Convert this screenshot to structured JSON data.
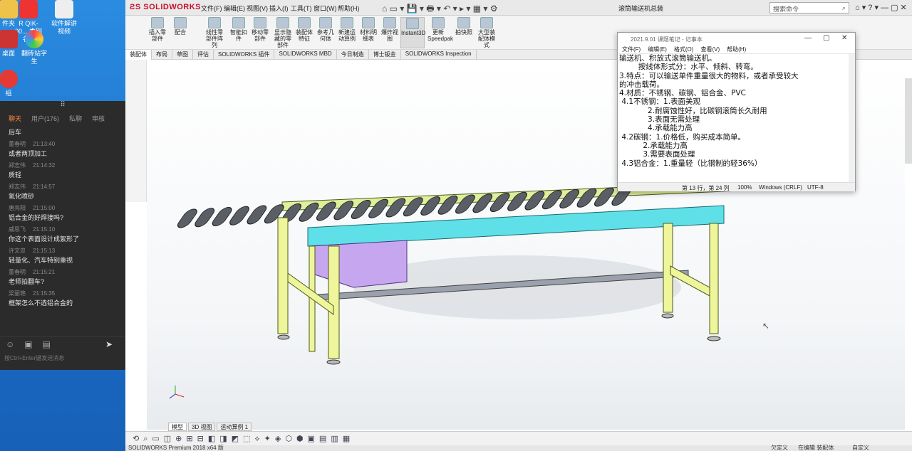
{
  "desktop": {
    "icons": [
      {
        "label": "件夹",
        "color": "#f1c24a"
      },
      {
        "label": "R QIK-00...\n类别名...",
        "color": "#e33"
      },
      {
        "label": "3",
        "color": "#ddd"
      },
      {
        "label": "软件解讲\n视频",
        "color": "#ddd"
      },
      {
        "label": "桌面",
        "color": "#c33"
      },
      {
        "label": "翻砖站字生",
        "color": "#4caf50"
      },
      {
        "label": "组",
        "color": "#e53935"
      }
    ]
  },
  "chat": {
    "tabs": [
      "聊天",
      "用户(176)",
      "私聊",
      "审核"
    ],
    "messages": [
      {
        "name": "",
        "time": "",
        "text": "后车"
      },
      {
        "name": "董春明",
        "time": "21:13:40",
        "text": "或者两顶加工"
      },
      {
        "name": "郑志伟",
        "time": "21:14:32",
        "text": "质轻"
      },
      {
        "name": "郑志伟",
        "time": "21:14:57",
        "text": "氧化喷砂"
      },
      {
        "name": "唐亮阳",
        "time": "21:15:00",
        "text": "铝合金的好焊接吗?"
      },
      {
        "name": "威思飞",
        "time": "21:15:10",
        "text": "你这个表面设计成絮形了"
      },
      {
        "name": "许文忠",
        "time": "21:15:13",
        "text": "轻量化、汽车特别重视"
      },
      {
        "name": "董春明",
        "time": "21:15:21",
        "text": "老师拍翻车?"
      },
      {
        "name": "梁丽艳",
        "time": "21:15:35",
        "text": "框架怎么不选铝合金的"
      }
    ],
    "hint": "按Ctrl+Enter键发送消息"
  },
  "solidworks": {
    "logo": "SOLIDWORKS",
    "menu": [
      "文件(F)",
      "编辑(E)",
      "视图(V)",
      "插入(I)",
      "工具(T)",
      "窗口(W)",
      "帮助(H)"
    ],
    "doc_title": "滚筒输送机总装",
    "search_placeholder": "搜索命令",
    "ribbon": [
      "插入零部件",
      "配合",
      "线性零部件阵列",
      "智能扣件",
      "移动零部件",
      "显示隐藏的零部件",
      "装配体特征",
      "参考几何体",
      "新建运动算例",
      "材料明细表",
      "爆炸视图",
      "Instant3D",
      "更新Speedpak",
      "拍快照",
      "大型装配体模式"
    ],
    "cm_tabs": [
      "装配体",
      "布局",
      "草图",
      "评估",
      "SOLIDWORKS 插件",
      "SOLIDWORKS MBD",
      "今日制造",
      "博士钣金",
      "SOLIDWORKS Inspection"
    ],
    "model_tabs": [
      "模型",
      "3D 视图",
      "运动算例 1"
    ],
    "status": "SOLIDWORKS Premium 2018 x64 版",
    "status_right": [
      "欠定义",
      "在编辑 装配体",
      "自定义"
    ]
  },
  "notepad": {
    "title": "2021.9.01 课题笔记 - 记事本",
    "menu": [
      "文件(F)",
      "编辑(E)",
      "格式(O)",
      "查看(V)",
      "帮助(H)"
    ],
    "lines": [
      "输送机、积放式滚筒输送机。",
      "        按线体形式分：水平、倾斜、转弯。",
      "3.特点：可以输送单件重量很大的物料，或者承受较大",
      "的冲击载荷。",
      "4.材质：不锈钢、碳钢、铝合金、PVC",
      " 4.1不锈钢：1.表面美观",
      "            2.耐腐蚀性好，比碳钢滚筒长久耐用",
      "            3.表面无需处理",
      "            4.承载能力高",
      " 4.2碳钢：1.价格低，购买成本简单。",
      "          2.承载能力高",
      "          3.需要表面处理",
      " 4.3铝合金：1.重量轻（比钢制的轻36%）"
    ],
    "status": {
      "pos": "第 13 行，第 24 列",
      "zoom": "100%",
      "eol": "Windows (CRLF)",
      "enc": "UTF-8"
    }
  }
}
